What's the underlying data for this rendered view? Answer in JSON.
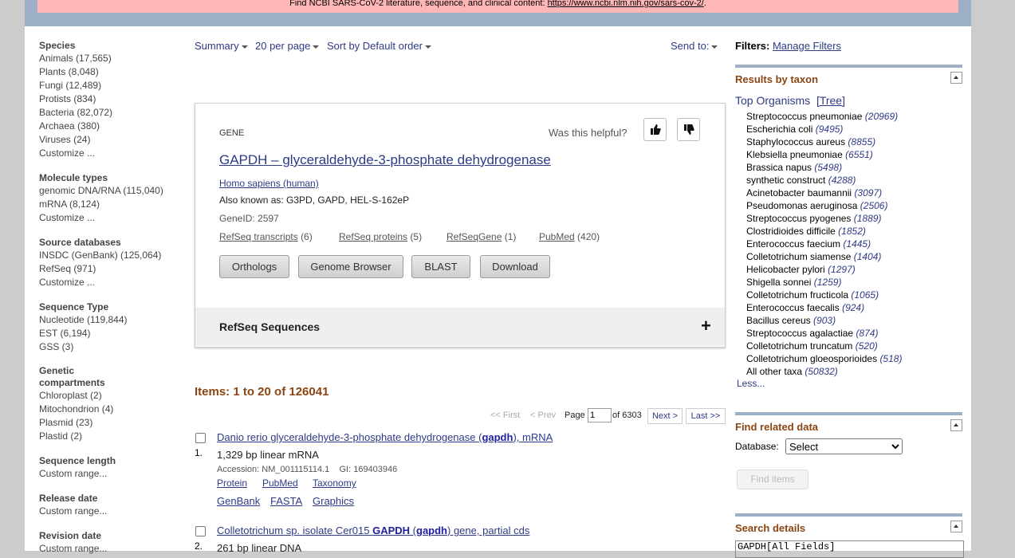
{
  "banner": {
    "text": "Find NCBI SARS-CoV-2 literature, sequence, and clinical content: ",
    "link": "https://www.ncbi.nlm.nih.gov/sars-cov-2/",
    "suffix": "."
  },
  "filters": {
    "groups": [
      {
        "title": "Species",
        "items": [
          "Animals (17,565)",
          "Plants (8,048)",
          "Fungi (12,489)",
          "Protists (834)",
          "Bacteria (82,072)",
          "Archaea (380)",
          "Viruses (24)",
          "Customize ..."
        ]
      },
      {
        "title": "Molecule types",
        "items": [
          "genomic DNA/RNA (115,040)",
          "mRNA (8,124)",
          "Customize ..."
        ]
      },
      {
        "title": "Source databases",
        "items": [
          "INSDC (GenBank) (125,064)",
          "RefSeq (971)",
          "Customize ..."
        ]
      },
      {
        "title": "Sequence Type",
        "items": [
          "Nucleotide (119,844)",
          "EST (6,194)",
          "GSS (3)"
        ]
      },
      {
        "title": "Genetic compartments",
        "items": [
          "Chloroplast (2)",
          "Mitochondrion (4)",
          "Plasmid (23)",
          "Plastid (2)"
        ]
      },
      {
        "title": "Sequence length",
        "items": [
          "Custom range..."
        ]
      },
      {
        "title": "Release date",
        "items": [
          "Custom range..."
        ]
      },
      {
        "title": "Revision date",
        "items": [
          "Custom range..."
        ]
      }
    ]
  },
  "toolbar": {
    "summary": "Summary",
    "per_page": "20 per page",
    "sort": "Sort by Default order",
    "send_to": "Send to:"
  },
  "gene": {
    "tag": "GENE",
    "helpful": "Was this helpful?",
    "title": "GAPDH – glyceraldehyde-3-phosphate dehydrogenase",
    "organism": "Homo sapiens (human)",
    "aka": "Also known as: G3PD, GAPD, HEL-S-162eP",
    "geneid": "GeneID: 2597",
    "links": [
      {
        "label": "RefSeq transcripts",
        "count": "(6)"
      },
      {
        "label": "RefSeq proteins",
        "count": "(5)"
      },
      {
        "label": "RefSeqGene",
        "count": "(1)"
      },
      {
        "label": "PubMed",
        "count": "(420)"
      }
    ],
    "buttons": [
      "Orthologs",
      "Genome Browser",
      "BLAST",
      "Download"
    ],
    "refseq_section": "RefSeq Sequences"
  },
  "results": {
    "count_label": "Items: 1 to 20 of 126041",
    "pager": {
      "first": "<< First",
      "prev": "< Prev",
      "page_label": "Page",
      "page_value": "1",
      "of_label": "of 6303",
      "next": "Next >",
      "last": "Last >>"
    },
    "items": [
      {
        "num": "1.",
        "title_pre": "Danio rerio glyceraldehyde-3-phosphate dehydrogenase (",
        "title_bold": "gapdh",
        "title_post": "), mRNA",
        "desc": "1,329 bp linear mRNA",
        "accession": "Accession: NM_001115114.1    GI: 169403946",
        "links1": [
          "Protein",
          "PubMed",
          "Taxonomy"
        ],
        "links2": [
          "GenBank",
          "FASTA",
          "Graphics"
        ]
      },
      {
        "num": "2.",
        "title_pre": "Colletotrichum sp. isolate Cer015 ",
        "title_bold": "GAPDH",
        "title_mid": " (",
        "title_bold2": "gapdh",
        "title_post": ") gene, partial cds",
        "desc": "261 bp linear DNA"
      }
    ]
  },
  "right": {
    "filters_label": "Filters:",
    "manage_filters": "Manage Filters",
    "taxon_title": "Results by taxon",
    "top_organisms": "Top Organisms",
    "tree": "[Tree]",
    "organisms": [
      {
        "name": "Streptococcus pneumoniae",
        "count": "(20969)"
      },
      {
        "name": "Escherichia coli",
        "count": "(9495)"
      },
      {
        "name": "Staphylococcus aureus",
        "count": "(8855)"
      },
      {
        "name": "Klebsiella pneumoniae",
        "count": "(6551)"
      },
      {
        "name": "Brassica napus",
        "count": "(5498)"
      },
      {
        "name": "synthetic construct",
        "count": "(4288)"
      },
      {
        "name": "Acinetobacter baumannii",
        "count": "(3097)"
      },
      {
        "name": "Pseudomonas aeruginosa",
        "count": "(2506)"
      },
      {
        "name": "Streptococcus pyogenes",
        "count": "(1889)"
      },
      {
        "name": "Clostridioides difficile",
        "count": "(1852)"
      },
      {
        "name": "Enterococcus faecium",
        "count": "(1445)"
      },
      {
        "name": "Colletotrichum siamense",
        "count": "(1404)"
      },
      {
        "name": "Helicobacter pylori",
        "count": "(1297)"
      },
      {
        "name": "Shigella sonnei",
        "count": "(1259)"
      },
      {
        "name": "Colletotrichum fructicola",
        "count": "(1065)"
      },
      {
        "name": "Enterococcus faecalis",
        "count": "(924)"
      },
      {
        "name": "Bacillus cereus",
        "count": "(903)"
      },
      {
        "name": "Streptococcus agalactiae",
        "count": "(874)"
      },
      {
        "name": "Colletotrichum truncatum",
        "count": "(520)"
      },
      {
        "name": "Colletotrichum gloeosporioides",
        "count": "(518)"
      },
      {
        "name": "All other taxa",
        "count": "(50832)"
      }
    ],
    "less": "Less...",
    "related_title": "Find related data",
    "database_label": "Database:",
    "database_value": "Select",
    "find_items": "Find items",
    "search_details_title": "Search details",
    "search_details_value": "GAPDH[All Fields]"
  }
}
